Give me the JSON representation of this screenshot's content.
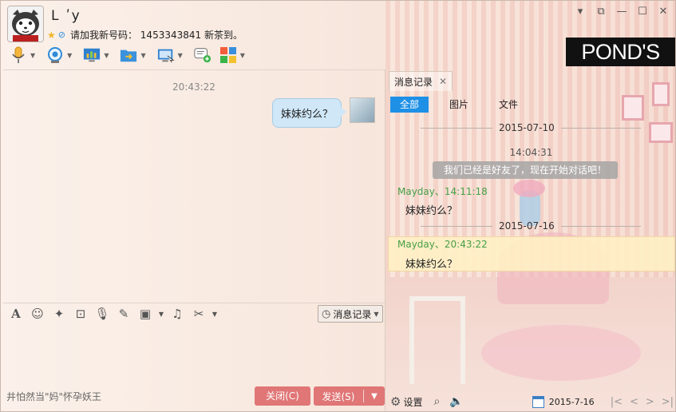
{
  "header": {
    "contact_name": "L ʹy",
    "signature": "请加我新号码： 1453343841  新茶到。",
    "brand_logo": "POND'S"
  },
  "window_controls": {
    "menu": "▾",
    "skin": "⧉",
    "minimize": "—",
    "maximize": "☐",
    "close": "✕"
  },
  "toolbar": {
    "items": [
      "microphone-icon",
      "video-camera-icon",
      "screen-share-icon",
      "file-transfer-icon",
      "remote-desktop-icon",
      "add-message-icon",
      "apps-grid-icon"
    ]
  },
  "chat": {
    "time": "20:43:22",
    "message": "妹妹约么？"
  },
  "input_toolbar": {
    "history_label": "消息记录"
  },
  "footer": {
    "ticker": "井怕然当\"妈\"怀孕妖王",
    "close_label": "关闭(C)",
    "send_label": "发送(S)"
  },
  "history": {
    "tab_label": "消息记录",
    "filters": [
      "全部",
      "图片",
      "文件"
    ],
    "date1": "2015-07-10",
    "time1": "14:04:31",
    "system_message": "我们已经是好友了，现在开始对话吧！",
    "msg1_head": "Mayday、14:11:18",
    "msg1_body": "妹妹约么？",
    "date2": "2015-07-16",
    "msg2_head": "Mayday、20:43:22",
    "msg2_body": "妹妹约么？",
    "settings_label": "设置",
    "current_date": "2015-7-16"
  },
  "colors": {
    "accent": "#1e90e6",
    "button": "#e07676",
    "sender": "#46a046"
  }
}
